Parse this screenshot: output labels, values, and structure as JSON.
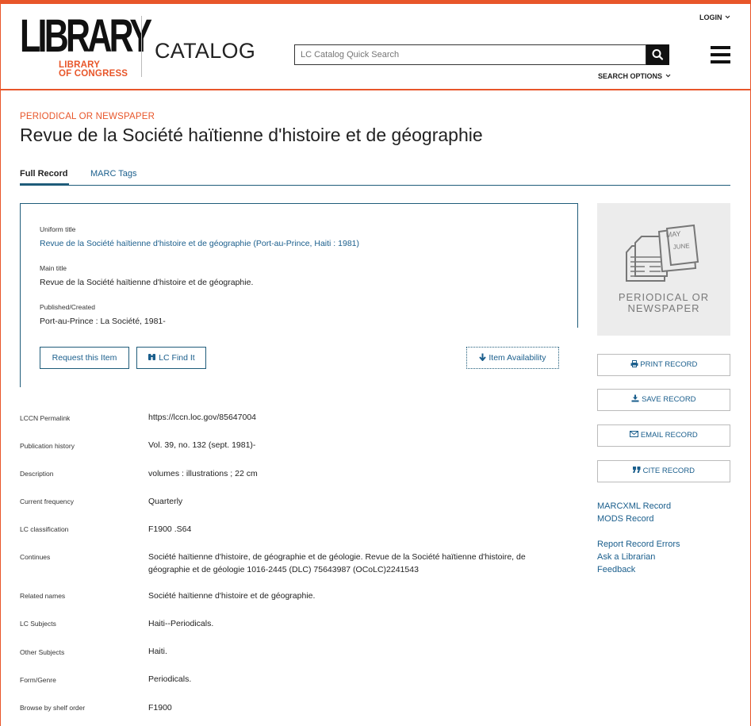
{
  "header": {
    "logo_main": "LIBRARY",
    "logo_sub": "LIBRARY\nOF CONGRESS",
    "catalog_label": "CATALOG",
    "login_label": "LOGIN",
    "search_placeholder": "LC Catalog Quick Search",
    "search_options_label": "SEARCH OPTIONS",
    "accent_color": "#e8562a"
  },
  "record": {
    "kicker": "PERIODICAL OR NEWSPAPER",
    "title": "Revue de la Société haïtienne d'histoire et de géographie"
  },
  "tabs": [
    {
      "label": "Full Record"
    },
    {
      "label": "MARC Tags"
    }
  ],
  "summary": {
    "fields": [
      {
        "label": "Uniform title",
        "value": "Revue de la Société haïtienne d'histoire et de géographie (Port-au-Prince, Haiti : 1981)"
      },
      {
        "label": "Main title",
        "value": "Revue de la Société haïtienne d'histoire et de géographie."
      },
      {
        "label": "Published/Created",
        "value": "Port-au-Prince : La Société, 1981-"
      }
    ],
    "buttons": {
      "request": "Request this Item",
      "find": "LC Find It",
      "availability": "Item Availability"
    }
  },
  "details": [
    {
      "label": "LCCN Permalink",
      "value": "https://lccn.loc.gov/85647004"
    },
    {
      "label": "Publication history",
      "value": "Vol. 39, no. 132 (sept. 1981)-"
    },
    {
      "label": "Description",
      "value": "volumes : illustrations ; 22 cm"
    },
    {
      "label": "Current frequency",
      "value": "Quarterly"
    },
    {
      "label": "LC classification",
      "value": "F1900 .S64"
    },
    {
      "label": "Continues",
      "value": "Société haïtienne d'histoire, de géographie et de géologie. Revue de la Société haïtienne d'histoire, de géographie et de géologie 1016-2445 (DLC) 75643987 (OCoLC)2241543"
    },
    {
      "label": "Related names",
      "value": "Société haïtienne d'histoire et de géographie."
    },
    {
      "label": "LC Subjects",
      "value": "Haiti--Periodicals."
    },
    {
      "label": "Other Subjects",
      "value": "Haiti."
    },
    {
      "label": "Form/Genre",
      "value": "Periodicals."
    },
    {
      "label": "Browse by shelf order",
      "value": "F1900"
    }
  ],
  "sidebar": {
    "thumb_caption": "PERIODICAL OR\nNEWSPAPER",
    "thumb_months": [
      "MAY",
      "JUNE"
    ],
    "actions": [
      {
        "label": "PRINT RECORD",
        "icon": "print-icon"
      },
      {
        "label": "SAVE RECORD",
        "icon": "download-icon"
      },
      {
        "label": "EMAIL RECORD",
        "icon": "envelope-icon"
      },
      {
        "label": "CITE RECORD",
        "icon": "quote-icon"
      }
    ],
    "links": [
      "MARCXML Record",
      "MODS Record",
      "Report Record Errors",
      "Ask a Librarian",
      "Feedback"
    ]
  }
}
